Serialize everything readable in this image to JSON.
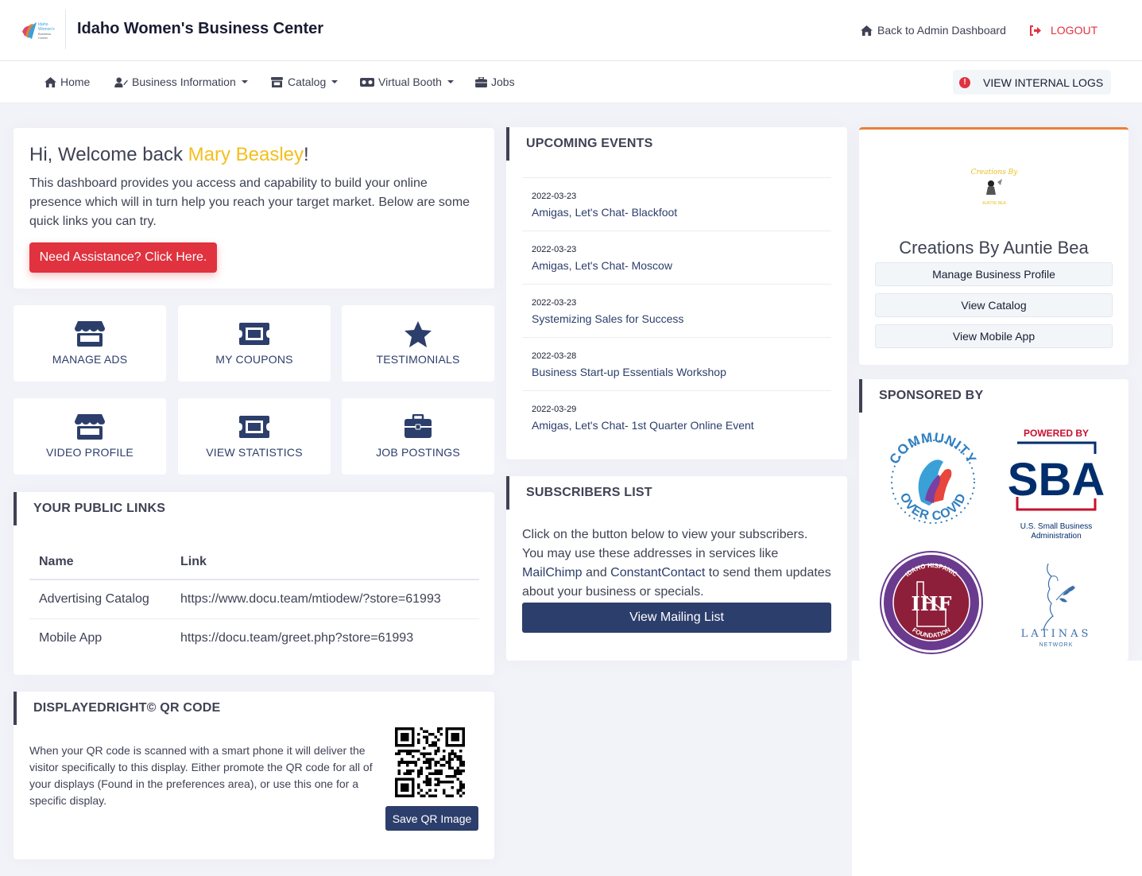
{
  "header": {
    "site_title": "Idaho Women's Business Center",
    "back_label": "Back to Admin Dashboard",
    "logout_label": "LOGOUT",
    "logo_text": [
      "Idaho",
      "Women's",
      "Business",
      "Center"
    ]
  },
  "nav": {
    "items": [
      {
        "label": "Home",
        "icon": "home-icon",
        "dropdown": false
      },
      {
        "label": "Business Information",
        "icon": "user-edit-icon",
        "dropdown": true
      },
      {
        "label": "Catalog",
        "icon": "store-icon",
        "dropdown": true
      },
      {
        "label": "Virtual Booth",
        "icon": "vr-icon",
        "dropdown": true
      },
      {
        "label": "Jobs",
        "icon": "briefcase-icon",
        "dropdown": false
      }
    ],
    "logs_label": "VIEW INTERNAL LOGS",
    "logs_alert": "!"
  },
  "welcome": {
    "greeting": "Hi, Welcome back ",
    "user_name": "Mary Beasley",
    "exclaim": "!",
    "description": "This dashboard provides you access and capability to build your online presence which will in turn help you reach your target market. Below are some quick links you can try.",
    "assist_label": "Need Assistance? Click Here."
  },
  "tiles": [
    {
      "label": "MANAGE ADS",
      "icon": "store-icon"
    },
    {
      "label": "MY COUPONS",
      "icon": "ticket-icon"
    },
    {
      "label": "TESTIMONIALS",
      "icon": "star-icon"
    },
    {
      "label": "VIDEO PROFILE",
      "icon": "store-icon"
    },
    {
      "label": "VIEW STATISTICS",
      "icon": "ticket-icon"
    },
    {
      "label": "JOB POSTINGS",
      "icon": "briefcase-icon"
    }
  ],
  "public_links": {
    "title": "YOUR PUBLIC LINKS",
    "headers": [
      "Name",
      "Link"
    ],
    "rows": [
      {
        "name": "Advertising Catalog",
        "link": "https://www.docu.team/mtiodew/?store=61993"
      },
      {
        "name": "Mobile App",
        "link": "https://docu.team/greet.php?store=61993"
      }
    ]
  },
  "qr": {
    "title": "DISPLAYEDRIGHT© QR CODE",
    "description": "When your QR code is scanned with a smart phone it will deliver the visitor specifically to this display. Either promote the QR code for all of your displays (Found in the preferences area), or use this one for a specific display.",
    "save_label": "Save QR Image"
  },
  "events": {
    "title": "UPCOMING EVENTS",
    "items": [
      {
        "date": "2022-03-23",
        "title": "Amigas, Let's Chat- Blackfoot"
      },
      {
        "date": "2022-03-23",
        "title": "Amigas, Let's Chat- Moscow"
      },
      {
        "date": "2022-03-23",
        "title": "Systemizing Sales for Success"
      },
      {
        "date": "2022-03-28",
        "title": "Business Start-up Essentials Workshop"
      },
      {
        "date": "2022-03-29",
        "title": "Amigas, Let's Chat- 1st Quarter Online Event"
      }
    ]
  },
  "subscribers": {
    "title": "SUBSCRIBERS LIST",
    "text_1": "Click on the button below to view your subscribers. You may use these addresses in services like ",
    "link_1": "MailChimp",
    "text_2": " and ",
    "link_2": "ConstantContact",
    "text_3": " to send them updates about your business or specials.",
    "button_label": "View Mailing List"
  },
  "business": {
    "logo_text": "Creations By",
    "logo_subtext": "AUNTIE BEA",
    "name": "Creations By Auntie Bea",
    "buttons": [
      "Manage Business Profile",
      "View Catalog",
      "View Mobile App"
    ]
  },
  "sponsors": {
    "title": "SPONSORED BY",
    "community": {
      "top": "COMMUNITY",
      "bottom": "OVER COVID"
    },
    "sba": {
      "powered": "POWERED BY",
      "letters": "SBA",
      "caption_1": "U.S. Small Business",
      "caption_2": "Administration"
    },
    "ihf": {
      "top": "IDAHO HISPANIC",
      "letters": "IHF",
      "bottom": "FOUNDATION"
    },
    "latinas": {
      "name": "LATINAS",
      "sub": "NETWORK"
    }
  },
  "colors": {
    "accent_yellow": "#f4be1e",
    "danger": "#e0323f",
    "primary": "#2c3e6b",
    "business_card_top": "#e8803a"
  }
}
